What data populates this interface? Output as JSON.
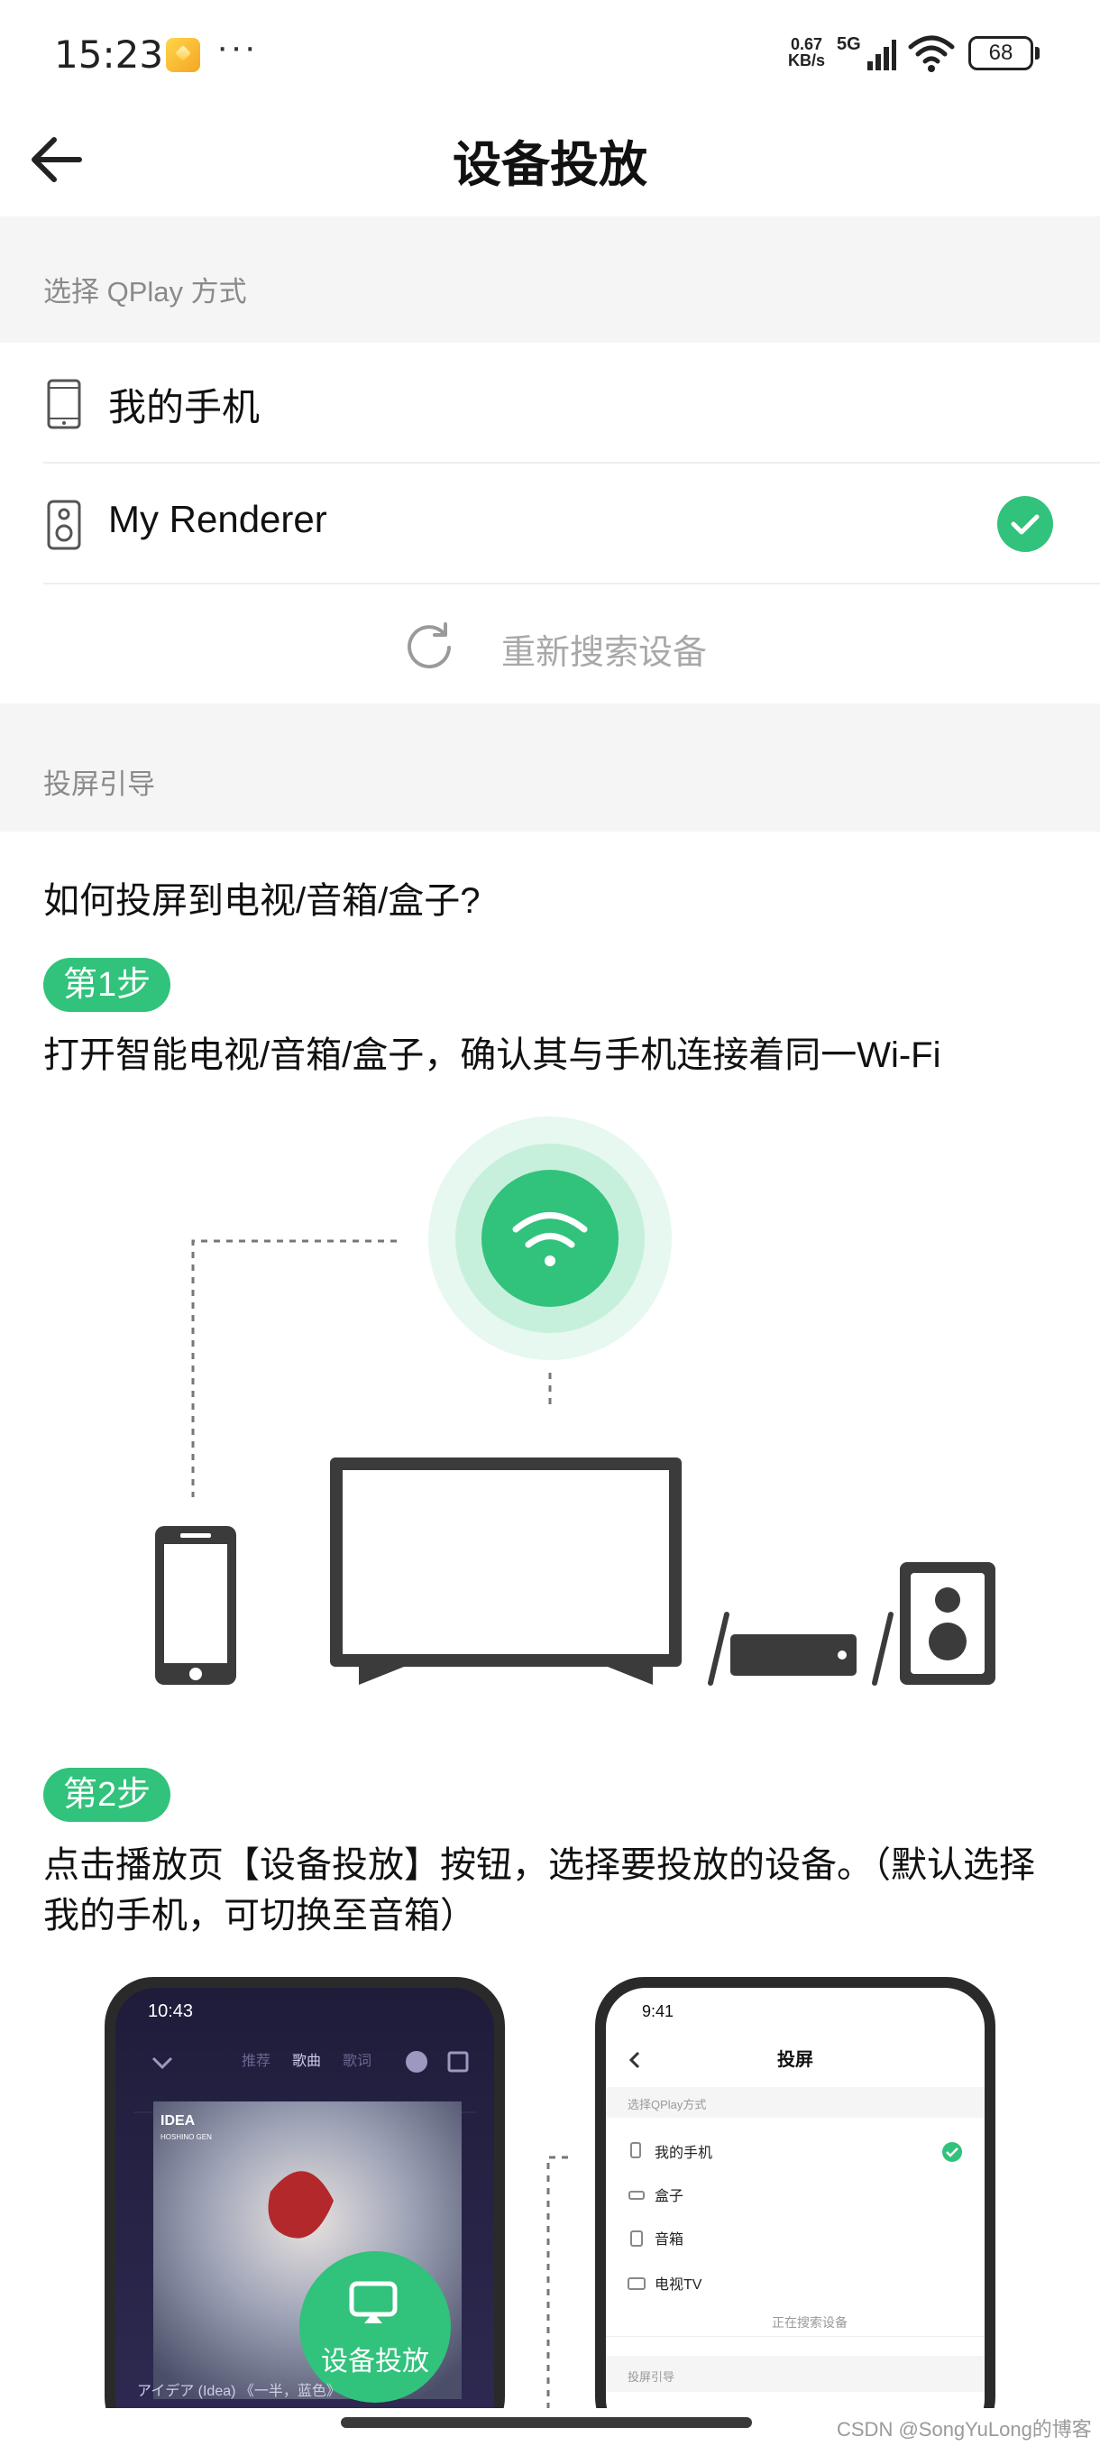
{
  "status_bar": {
    "time": "15:23",
    "more": "···",
    "net_speed_value": "0.67",
    "net_speed_unit": "KB/s",
    "network_type": "5G",
    "battery": "68"
  },
  "header": {
    "title": "设备投放",
    "back_icon": "arrow-left-icon"
  },
  "section_qplay": {
    "label": "选择 QPlay 方式",
    "devices": [
      {
        "label": "我的手机",
        "icon": "phone-icon",
        "selected": false
      },
      {
        "label": "My Renderer",
        "icon": "speaker-icon",
        "selected": true
      }
    ],
    "refresh_label": "重新搜索设备"
  },
  "section_guide": {
    "label": "投屏引导",
    "question": "如何投屏到电视/音箱/盒子?",
    "step1_badge": "第1步",
    "step1_text": "打开智能电视/音箱/盒子，确认其与手机连接着同一Wi-Fi",
    "step2_badge": "第2步",
    "step2_text": "点击播放页【设备投放】按钮，选择要投放的设备。（默认选择我的手机，可切换至音箱）"
  },
  "phone_left": {
    "time": "10:43",
    "tabs": [
      "推荐",
      "歌曲",
      "歌词"
    ],
    "album_title": "IDEA",
    "album_sub": "HOSHINO GEN",
    "song": "アイデア (Idea) 《一半，蓝色》",
    "cast_button": "设备投放"
  },
  "phone_right": {
    "time": "9:41",
    "title": "投屏",
    "section_label": "选择QPlay方式",
    "items": [
      "我的手机",
      "盒子",
      "音箱",
      "电视TV"
    ],
    "searching": "正在搜索设备",
    "guide_label": "投屏引导"
  },
  "watermark": "CSDN @SongYuLong的博客",
  "colors": {
    "accent": "#31c27c",
    "section_bg": "#f5f5f5",
    "muted_text": "#8a8a8a"
  }
}
